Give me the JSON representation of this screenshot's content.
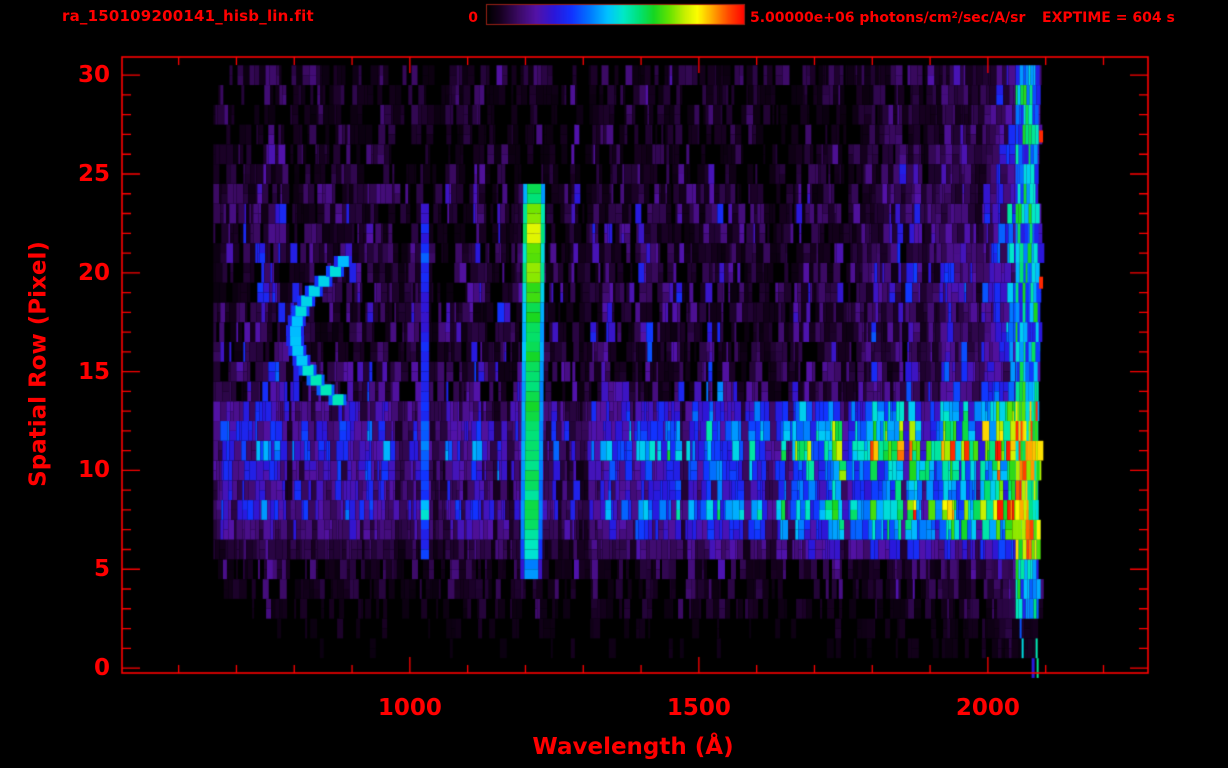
{
  "colors": {
    "background": "#000000",
    "text": "#ff0000",
    "frame": "#ff0000",
    "colorbar_border": "#992015"
  },
  "header": {
    "title": "ra_150109200141_hisb_lin.fit",
    "colorbar_min_label": "0",
    "colorbar_max_value": "5.00000e+06",
    "colorbar_units_pre": " photons/cm",
    "colorbar_units_sup": "2",
    "colorbar_units_post": "/sec/A/sr",
    "exptime_label": "EXPTIME = 604 s"
  },
  "chart_data": {
    "type": "heatmap",
    "title": "ra_150109200141_hisb_lin.fit",
    "xlabel": "Wavelength (Å)",
    "ylabel": "Spatial Row (Pixel)",
    "x_range": [
      502,
      2277
    ],
    "y_range": [
      -0.25,
      30.92
    ],
    "x_ticks": {
      "major": [
        1000,
        1500,
        2000
      ],
      "minor_start": 600,
      "minor_end": 2200,
      "minor_step": 100
    },
    "y_ticks": {
      "major": [
        0,
        5,
        10,
        15,
        20,
        25,
        30
      ],
      "minor_start": 0,
      "minor_end": 30,
      "minor_step": 1
    },
    "grid": false,
    "colorbar": {
      "min": 0,
      "max": 5000000,
      "min_label": "0",
      "max_label": "5.00000e+06",
      "units": "photons/cm2/sec/A/sr",
      "colormap": "rainbow",
      "position": "top"
    },
    "exposure_time_s": 604,
    "seed": 1234,
    "data_extent": {
      "wl_start": 660,
      "wl_end": 2086,
      "rows": 31
    },
    "row_profiles_format": "[start_wavelength_A, base_intensity_0to1, rightward_gain_0to1] for spatial rows 0..30",
    "row_profiles": [
      [
        900,
        0.01,
        0.0
      ],
      [
        820,
        0.015,
        0.04
      ],
      [
        760,
        0.022,
        0.05
      ],
      [
        715,
        0.045,
        0.06
      ],
      [
        678,
        0.06,
        0.08
      ],
      [
        668,
        0.075,
        0.1
      ],
      [
        660,
        0.12,
        0.22
      ],
      [
        660,
        0.2,
        0.52
      ],
      [
        660,
        0.3,
        0.62
      ],
      [
        660,
        0.21,
        0.42
      ],
      [
        660,
        0.24,
        0.52
      ],
      [
        660,
        0.32,
        0.72
      ],
      [
        660,
        0.3,
        0.55
      ],
      [
        660,
        0.23,
        0.38
      ],
      [
        660,
        0.14,
        0.26
      ],
      [
        660,
        0.12,
        0.24
      ],
      [
        660,
        0.115,
        0.22
      ],
      [
        660,
        0.115,
        0.22
      ],
      [
        660,
        0.12,
        0.24
      ],
      [
        660,
        0.12,
        0.26
      ],
      [
        660,
        0.115,
        0.24
      ],
      [
        660,
        0.11,
        0.22
      ],
      [
        660,
        0.11,
        0.24
      ],
      [
        660,
        0.105,
        0.2
      ],
      [
        660,
        0.095,
        0.19
      ],
      [
        660,
        0.07,
        0.16
      ],
      [
        660,
        0.07,
        0.17
      ],
      [
        660,
        0.06,
        0.15
      ],
      [
        660,
        0.065,
        0.14
      ],
      [
        660,
        0.058,
        0.12
      ],
      [
        688,
        0.075,
        0.1
      ]
    ],
    "features": {
      "lyman_alpha_line": {
        "wl_center": 1215,
        "wl_core_width": 24,
        "row_min": 5,
        "row_max": 24,
        "row_intensities": [
          0.42,
          0.52,
          0.58,
          0.6,
          0.58,
          0.6,
          0.62,
          0.6,
          0.62,
          0.6,
          0.62,
          0.64,
          0.62,
          0.64,
          0.68,
          0.76,
          0.7,
          0.78,
          0.74,
          0.62
        ]
      },
      "lyman_beta_line": {
        "wl_center": 1026,
        "wl_width": 14,
        "row_min": 6,
        "row_max": 23,
        "intensity": 0.28
      },
      "airglow_arc": {
        "wl_vertex": 801,
        "wl_tips": 884,
        "row_vertex": 16.9,
        "row_min": 13.6,
        "row_max": 20.6,
        "intensity": 0.5
      },
      "detector_edge_band": {
        "wl_start": 2048,
        "wl_end": 2086,
        "intensity_dim": 0.3,
        "intensity_bright": 0.72,
        "bright_row_min": 6,
        "bright_row_max": 13
      },
      "red_edge_marks": {
        "wl": 2092,
        "rows": [
          19.5,
          26.9
        ],
        "intensity": 0.97
      }
    },
    "colormap_stops": [
      [
        0.0,
        "#000000"
      ],
      [
        0.05,
        "#16001f"
      ],
      [
        0.12,
        "#3b0a63"
      ],
      [
        0.19,
        "#5312a6"
      ],
      [
        0.26,
        "#2b16d9"
      ],
      [
        0.33,
        "#1133ff"
      ],
      [
        0.4,
        "#0077ff"
      ],
      [
        0.47,
        "#00c3ff"
      ],
      [
        0.53,
        "#00e9c8"
      ],
      [
        0.59,
        "#00e27a"
      ],
      [
        0.65,
        "#16d621"
      ],
      [
        0.71,
        "#64e300"
      ],
      [
        0.77,
        "#c6ef00"
      ],
      [
        0.82,
        "#fdfd00"
      ],
      [
        0.88,
        "#ffa500"
      ],
      [
        0.94,
        "#ff4a00"
      ],
      [
        1.0,
        "#ff0600"
      ]
    ]
  }
}
